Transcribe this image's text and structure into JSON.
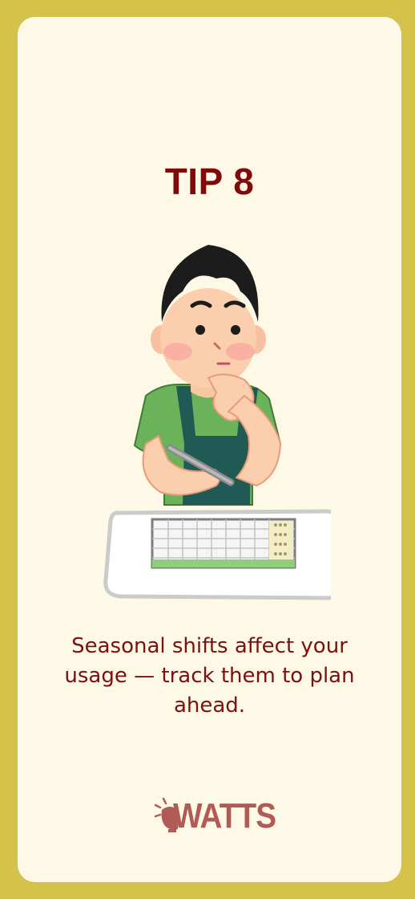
{
  "tip": {
    "title": "TIP 8",
    "caption": "Seasonal shifts affect your usage — track them to plan ahead."
  },
  "illustration": {
    "subject": "man-thinking-over-calendar",
    "icons": [
      "pen-icon",
      "calendar-icon"
    ]
  },
  "brand": {
    "name": "WATTS",
    "icon": "lightbulb-icon"
  },
  "colors": {
    "frame": "#d4c24a",
    "card": "#fdf9e6",
    "title": "#7f0a0a",
    "caption": "#7a1010",
    "logo": "#b25a55"
  }
}
